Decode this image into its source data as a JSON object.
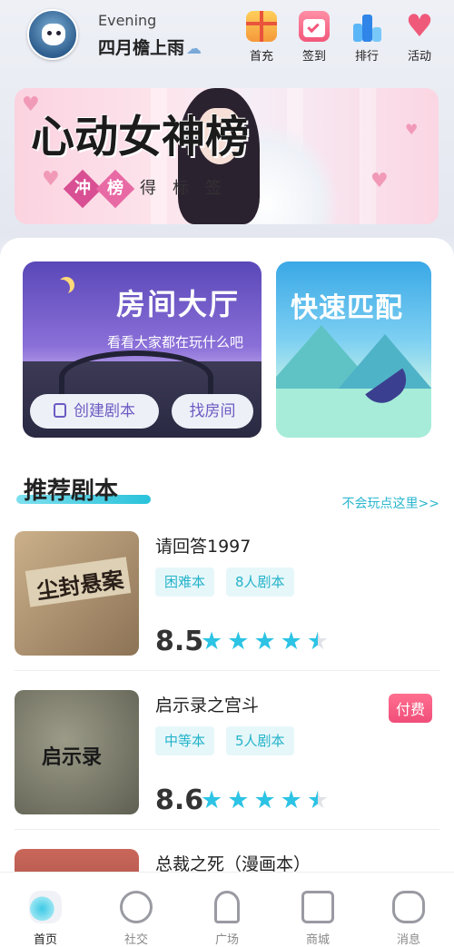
{
  "user": {
    "greeting": "Evening",
    "name": "四月檐上雨",
    "weather_icon": "cloud-rain-icon"
  },
  "top_actions": [
    {
      "label": "首充",
      "icon": "gift-icon",
      "color": "#f6a23a"
    },
    {
      "label": "签到",
      "icon": "calendar-check-icon",
      "color": "#f66a86"
    },
    {
      "label": "排行",
      "icon": "podium-icon",
      "color": "#3a9df2"
    },
    {
      "label": "活动",
      "icon": "heart-icon",
      "color": "#f05a7a"
    }
  ],
  "banner": {
    "title": "心动女神榜",
    "subtitle": [
      "冲",
      "榜",
      "得",
      "标",
      "签"
    ]
  },
  "lobby_card": {
    "title": "房间大厅",
    "desc": "看看大家都在玩什么吧",
    "create_label": "创建剧本",
    "find_label": "找房间"
  },
  "match_card": {
    "title": "快速匹配"
  },
  "section": {
    "title": "推荐剧本",
    "help_link": "不会玩点这里>>"
  },
  "scripts": [
    {
      "name": "请回答1997",
      "tags": [
        "困难本",
        "8人剧本"
      ],
      "score": "8.5",
      "rating": 4.5,
      "cover_text": "尘封悬案",
      "cover_color": "#b89a74",
      "paid": ""
    },
    {
      "name": "启示录之宫斗",
      "tags": [
        "中等本",
        "5人剧本"
      ],
      "score": "8.6",
      "rating": 4.5,
      "cover_text": "启示录",
      "cover_color": "#7f806e",
      "paid": "付费"
    },
    {
      "name": "总裁之死（漫画本）",
      "tags": [],
      "score": "",
      "rating": 0,
      "cover_text": "",
      "cover_color": "#b85a4a",
      "paid": ""
    }
  ],
  "bottom_nav": [
    {
      "label": "首页",
      "icon": "cat-home-icon",
      "active": true
    },
    {
      "label": "社交",
      "icon": "planet-icon",
      "active": false
    },
    {
      "label": "广场",
      "icon": "square-icon",
      "active": false
    },
    {
      "label": "商城",
      "icon": "shop-icon",
      "active": false
    },
    {
      "label": "消息",
      "icon": "message-icon",
      "active": false
    }
  ]
}
